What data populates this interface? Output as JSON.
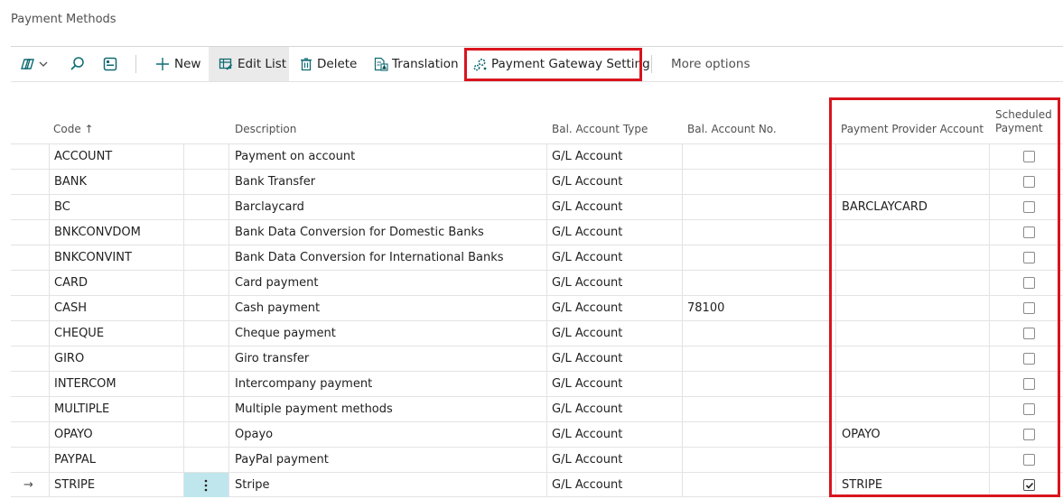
{
  "page": {
    "title": "Payment Methods"
  },
  "toolbar": {
    "new_label": "New",
    "edit_list_label": "Edit List",
    "delete_label": "Delete",
    "translation_label": "Translation",
    "payment_gateway_label": "Payment Gateway Setting",
    "more_options_label": "More options"
  },
  "columns": {
    "code": "Code ↑",
    "description": "Description",
    "bal_account_type": "Bal. Account Type",
    "bal_account_no": "Bal. Account No.",
    "payment_provider_account": "Payment Provider Account",
    "scheduled_payment_line1": "Scheduled",
    "scheduled_payment_line2": "Payment"
  },
  "current_row_marker": "→",
  "rows": [
    {
      "code": "ACCOUNT",
      "description": "Payment on account",
      "bal_type": "G/L Account",
      "bal_no": "",
      "provider": "",
      "scheduled": false
    },
    {
      "code": "BANK",
      "description": "Bank Transfer",
      "bal_type": "G/L Account",
      "bal_no": "",
      "provider": "",
      "scheduled": false
    },
    {
      "code": "BC",
      "description": "Barclaycard",
      "bal_type": "G/L Account",
      "bal_no": "",
      "provider": "BARCLAYCARD",
      "scheduled": false
    },
    {
      "code": "BNKCONVDOM",
      "description": "Bank Data Conversion for Domestic Banks",
      "bal_type": "G/L Account",
      "bal_no": "",
      "provider": "",
      "scheduled": false
    },
    {
      "code": "BNKCONVINT",
      "description": "Bank Data Conversion for International Banks",
      "bal_type": "G/L Account",
      "bal_no": "",
      "provider": "",
      "scheduled": false
    },
    {
      "code": "CARD",
      "description": "Card payment",
      "bal_type": "G/L Account",
      "bal_no": "",
      "provider": "",
      "scheduled": false
    },
    {
      "code": "CASH",
      "description": "Cash payment",
      "bal_type": "G/L Account",
      "bal_no": "78100",
      "provider": "",
      "scheduled": false
    },
    {
      "code": "CHEQUE",
      "description": "Cheque payment",
      "bal_type": "G/L Account",
      "bal_no": "",
      "provider": "",
      "scheduled": false
    },
    {
      "code": "GIRO",
      "description": "Giro transfer",
      "bal_type": "G/L Account",
      "bal_no": "",
      "provider": "",
      "scheduled": false
    },
    {
      "code": "INTERCOM",
      "description": "Intercompany payment",
      "bal_type": "G/L Account",
      "bal_no": "",
      "provider": "",
      "scheduled": false
    },
    {
      "code": "MULTIPLE",
      "description": "Multiple payment methods",
      "bal_type": "G/L Account",
      "bal_no": "",
      "provider": "",
      "scheduled": false
    },
    {
      "code": "OPAYO",
      "description": "Opayo",
      "bal_type": "G/L Account",
      "bal_no": "",
      "provider": "OPAYO",
      "scheduled": false
    },
    {
      "code": "PAYPAL",
      "description": "PayPal payment",
      "bal_type": "G/L Account",
      "bal_no": "",
      "provider": "",
      "scheduled": false
    },
    {
      "code": "STRIPE",
      "description": "Stripe",
      "bal_type": "G/L Account",
      "bal_no": "",
      "provider": "STRIPE",
      "scheduled": true,
      "current": true
    }
  ]
}
